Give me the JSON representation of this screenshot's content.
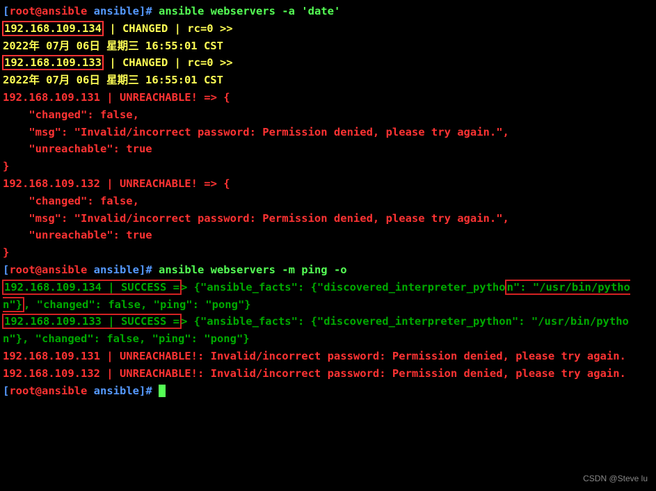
{
  "prompt1": {
    "bracket_open": "[",
    "user": "root@ansible",
    "path": " ansible",
    "bracket_close": "]#",
    "command": " ansible webservers -a 'date'"
  },
  "host134": {
    "ip": "192.168.109.134",
    "status": " | CHANGED | rc=0 >>",
    "date": "2022年 07月 06日 星期三 16:55:01 CST"
  },
  "host133": {
    "ip": "192.168.109.133",
    "status": " | CHANGED | rc=0 >>",
    "date": "2022年 07月 06日 星期三 16:55:01 CST"
  },
  "host131": {
    "header": "192.168.109.131 | UNREACHABLE! => {",
    "l1": "    \"changed\": false,",
    "l2": "    \"msg\": \"Invalid/incorrect password: Permission denied, please try again.\",",
    "l3": "    \"unreachable\": true",
    "l4": "}"
  },
  "host132": {
    "header": "192.168.109.132 | UNREACHABLE! => {",
    "l1": "    \"changed\": false,",
    "l2": "    \"msg\": \"Invalid/incorrect password: Permission denied, please try again.\",",
    "l3": "    \"unreachable\": true",
    "l4": "}"
  },
  "prompt2": {
    "bracket_open": "[",
    "user": "root@ansible",
    "path": " ansible",
    "bracket_close": "]#",
    "command": " ansible webservers -m ping -o"
  },
  "ping134": {
    "part1": "192.168.109.134 | SUCCESS =",
    "part2": "> {\"ansible_facts\": {\"discovered_interpreter_pytho",
    "part3": "n\": \"/usr/bin/python\"}",
    "part4": ", \"changed\": false, \"ping\": \"pong\"}"
  },
  "ping133": {
    "part1": "192.168.109.133 | SUCCESS =",
    "part2": "> {\"ansible_facts\": {\"discovered_interpreter_pytho",
    "part3": "n\": \"/usr/bin/python\"}",
    "part4": ", \"changed\": false, \"ping\": \"pong\"}"
  },
  "ping131": "192.168.109.131 | UNREACHABLE!: Invalid/incorrect password: Permission denied, please try again.",
  "ping132": "192.168.109.132 | UNREACHABLE!: Invalid/incorrect password: Permission denied, please try again.",
  "prompt3": {
    "bracket_open": "[",
    "user": "root@ansible",
    "path": " ansible",
    "bracket_close": "]#",
    "command": " "
  },
  "watermark": "CSDN @Steve lu"
}
